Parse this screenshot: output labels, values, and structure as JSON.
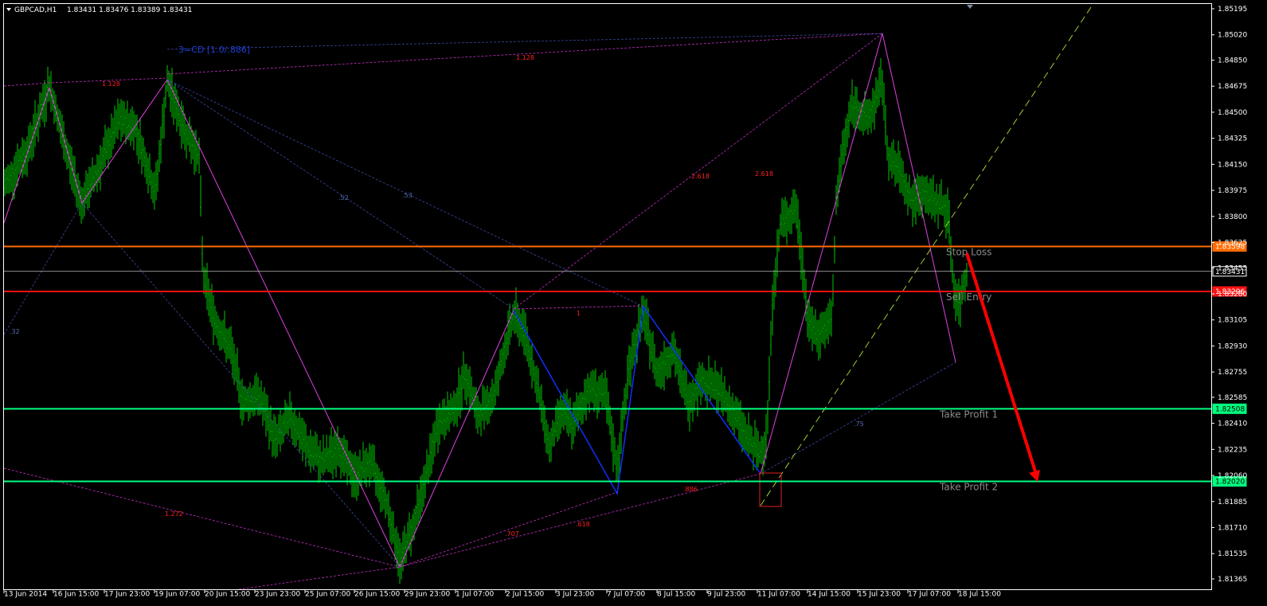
{
  "header": {
    "symbol": "GBPCAD,H1",
    "ohlc": "1.83431 1.83476 1.83389 1.83431"
  },
  "colors": {
    "background": "#000000",
    "candles": "#00c800",
    "frame": "#ffffff",
    "stop_loss": "#ff6a00",
    "sell_entry": "#ff1010",
    "take_profit": "#00ff7f",
    "current_price": "#c0c0c0",
    "pattern_magenta": "#e040e0",
    "pattern_blue": "#1030ff",
    "trend_line": "#9acd32",
    "arrow": "#ff0000"
  },
  "chart_data": {
    "type": "candlestick",
    "symbol": "GBPCAD",
    "timeframe": "H1",
    "y_ticks": [
      "1.85195",
      "1.85020",
      "1.84850",
      "1.84675",
      "1.84500",
      "1.84325",
      "1.84150",
      "1.83975",
      "1.83800",
      "1.83625",
      "1.83455",
      "1.83280",
      "1.83105",
      "1.82930",
      "1.82755",
      "1.82585",
      "1.82410",
      "1.82235",
      "1.82060",
      "1.81885",
      "1.81710",
      "1.81535",
      "1.81365"
    ],
    "x_ticks": [
      "13 Jun 2014",
      "16 Jun 15:00",
      "17 Jun 23:00",
      "19 Jun 07:00",
      "20 Jun 15:00",
      "23 Jun 23:00",
      "25 Jun 07:00",
      "26 Jun 15:00",
      "29 Jun 23:00",
      "1 Jul 07:00",
      "2 Jul 15:00",
      "3 Jul 23:00",
      "7 Jul 07:00",
      "8 Jul 15:00",
      "9 Jul 23:00",
      "11 Jul 07:00",
      "14 Jul 15:00",
      "15 Jul 23:00",
      "17 Jul 07:00",
      "18 Jul 15:00"
    ],
    "ylim": [
      1.813,
      1.8525
    ],
    "price_path": [
      {
        "x": 5,
        "y": 1.84
      },
      {
        "x": 35,
        "y": 1.8425
      },
      {
        "x": 62,
        "y": 1.8468
      },
      {
        "x": 80,
        "y": 1.843
      },
      {
        "x": 103,
        "y": 1.8389
      },
      {
        "x": 130,
        "y": 1.842
      },
      {
        "x": 150,
        "y": 1.8445
      },
      {
        "x": 170,
        "y": 1.844
      },
      {
        "x": 195,
        "y": 1.8395
      },
      {
        "x": 210,
        "y": 1.847
      },
      {
        "x": 230,
        "y": 1.844
      },
      {
        "x": 250,
        "y": 1.842
      },
      {
        "x": 255,
        "y": 1.834
      },
      {
        "x": 270,
        "y": 1.831
      },
      {
        "x": 290,
        "y": 1.829
      },
      {
        "x": 305,
        "y": 1.8255
      },
      {
        "x": 325,
        "y": 1.826
      },
      {
        "x": 345,
        "y": 1.823
      },
      {
        "x": 365,
        "y": 1.8245
      },
      {
        "x": 385,
        "y": 1.8225
      },
      {
        "x": 405,
        "y": 1.8215
      },
      {
        "x": 425,
        "y": 1.8225
      },
      {
        "x": 445,
        "y": 1.8205
      },
      {
        "x": 465,
        "y": 1.8215
      },
      {
        "x": 485,
        "y": 1.819
      },
      {
        "x": 502,
        "y": 1.8148
      },
      {
        "x": 520,
        "y": 1.8175
      },
      {
        "x": 535,
        "y": 1.8205
      },
      {
        "x": 550,
        "y": 1.824
      },
      {
        "x": 570,
        "y": 1.825
      },
      {
        "x": 585,
        "y": 1.8275
      },
      {
        "x": 600,
        "y": 1.8245
      },
      {
        "x": 620,
        "y": 1.826
      },
      {
        "x": 645,
        "y": 1.8315
      },
      {
        "x": 660,
        "y": 1.83
      },
      {
        "x": 675,
        "y": 1.8265
      },
      {
        "x": 690,
        "y": 1.8225
      },
      {
        "x": 705,
        "y": 1.825
      },
      {
        "x": 720,
        "y": 1.824
      },
      {
        "x": 740,
        "y": 1.8265
      },
      {
        "x": 760,
        "y": 1.826
      },
      {
        "x": 775,
        "y": 1.821
      },
      {
        "x": 790,
        "y": 1.828
      },
      {
        "x": 808,
        "y": 1.8315
      },
      {
        "x": 825,
        "y": 1.8275
      },
      {
        "x": 845,
        "y": 1.829
      },
      {
        "x": 865,
        "y": 1.8255
      },
      {
        "x": 880,
        "y": 1.827
      },
      {
        "x": 900,
        "y": 1.8265
      },
      {
        "x": 920,
        "y": 1.825
      },
      {
        "x": 940,
        "y": 1.823
      },
      {
        "x": 955,
        "y": 1.822
      },
      {
        "x": 963,
        "y": 1.8235
      },
      {
        "x": 970,
        "y": 1.832
      },
      {
        "x": 980,
        "y": 1.8375
      },
      {
        "x": 1000,
        "y": 1.8385
      },
      {
        "x": 1015,
        "y": 1.831
      },
      {
        "x": 1025,
        "y": 1.83
      },
      {
        "x": 1045,
        "y": 1.831
      },
      {
        "x": 1050,
        "y": 1.839
      },
      {
        "x": 1060,
        "y": 1.843
      },
      {
        "x": 1070,
        "y": 1.8455
      },
      {
        "x": 1090,
        "y": 1.8445
      },
      {
        "x": 1108,
        "y": 1.847
      },
      {
        "x": 1115,
        "y": 1.842
      },
      {
        "x": 1130,
        "y": 1.841
      },
      {
        "x": 1145,
        "y": 1.839
      },
      {
        "x": 1160,
        "y": 1.8395
      },
      {
        "x": 1175,
        "y": 1.839
      },
      {
        "x": 1190,
        "y": 1.8385
      },
      {
        "x": 1198,
        "y": 1.833
      },
      {
        "x": 1205,
        "y": 1.832
      },
      {
        "x": 1215,
        "y": 1.8345
      }
    ],
    "horizontal_levels": [
      {
        "name": "Stop Loss",
        "price": 1.83598,
        "tag": "1.83598",
        "label": "Stop Loss"
      },
      {
        "name": "Current Price",
        "price": 1.83431,
        "tag": "1.83431",
        "label": ""
      },
      {
        "name": "Sell Entry",
        "price": 1.83296,
        "tag": "1.83296",
        "label": "Sell Entry"
      },
      {
        "name": "Take Profit 1",
        "price": 1.82508,
        "tag": "1.82508",
        "label": "Take Profit 1"
      },
      {
        "name": "Take Profit 2",
        "price": 1.8202,
        "tag": "1.82020",
        "label": "Take Profit 2"
      }
    ],
    "pattern_label": "3=CD [1.0/.886]",
    "fib_labels": [
      {
        "text": "1.128",
        "color": "red"
      },
      {
        "text": "1.128",
        "color": "red"
      },
      {
        "text": "2.618",
        "color": "red"
      },
      {
        "text": "2.618",
        "color": "red"
      },
      {
        "text": "1",
        "color": "red"
      },
      {
        "text": "1.272",
        "color": "red"
      },
      {
        "text": ".707",
        "color": "red"
      },
      {
        "text": ".618",
        "color": "red"
      },
      {
        "text": ".886",
        "color": "red"
      },
      {
        "text": ".52",
        "color": "blue"
      },
      {
        "text": ".53",
        "color": "blue"
      },
      {
        "text": ".32",
        "color": "blue"
      },
      {
        "text": ".75",
        "color": "blue"
      }
    ]
  }
}
